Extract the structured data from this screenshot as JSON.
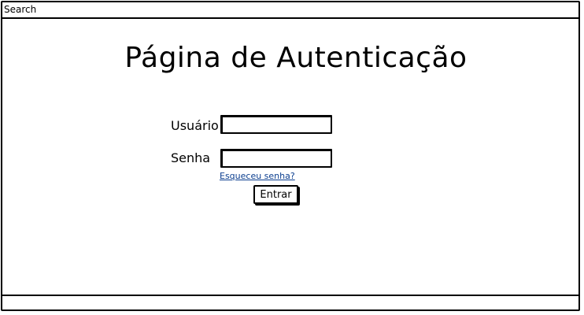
{
  "topbar": {
    "search_label": "Search"
  },
  "page": {
    "title": "Página de Autenticação"
  },
  "form": {
    "username_label": "Usuário",
    "password_label": "Senha",
    "forgot_link": "Esqueceu senha?",
    "submit_label": "Entrar"
  }
}
